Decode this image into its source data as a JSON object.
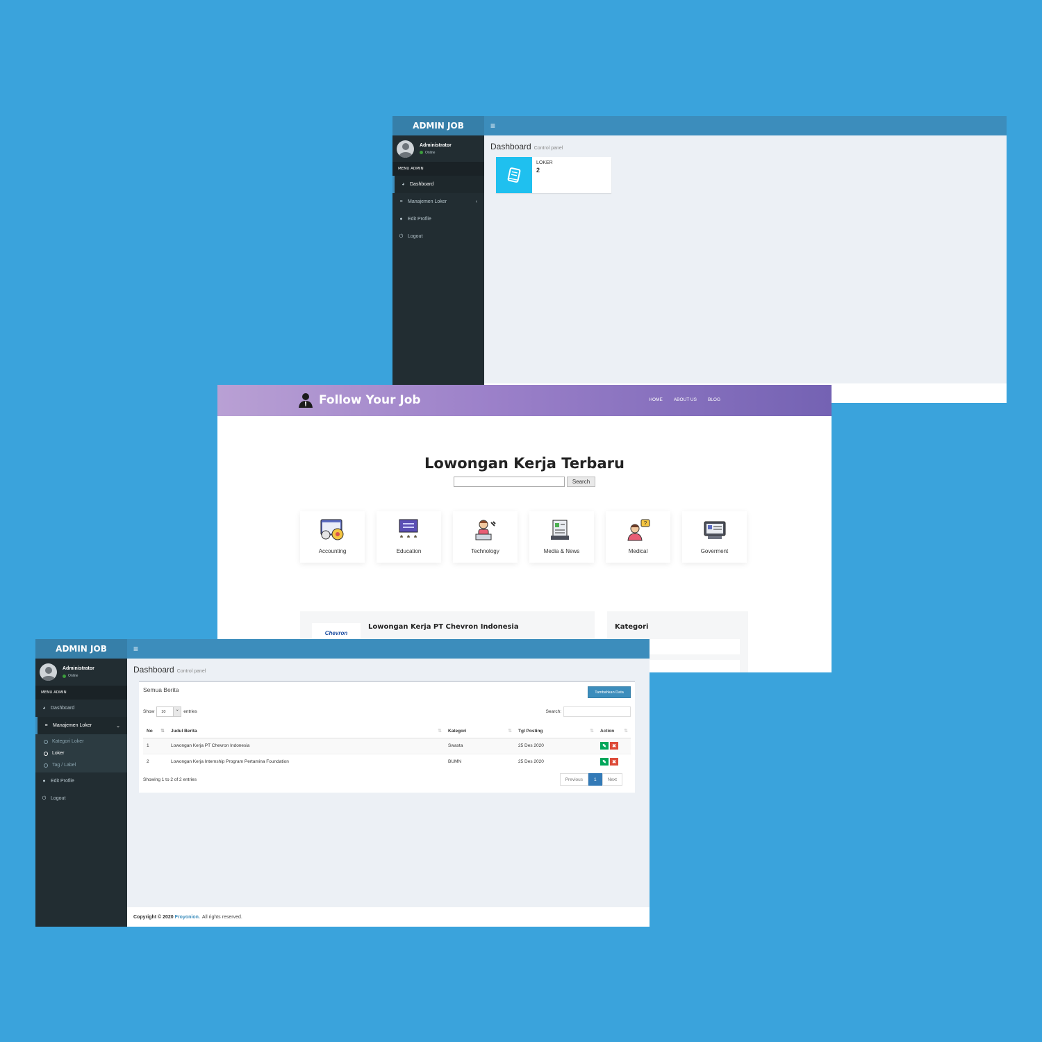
{
  "admin1": {
    "brand": "ADMIN JOB",
    "user": {
      "name": "Administrator",
      "status": "Online"
    },
    "menu_header": "MENU ADMIN",
    "menu": [
      {
        "label": "Dashboard",
        "icon": "dashboard-icon"
      },
      {
        "label": "Manajemen Loker",
        "icon": "list-icon"
      },
      {
        "label": "Edit Profile",
        "icon": "user-icon"
      },
      {
        "label": "Logout",
        "icon": "power-icon"
      }
    ],
    "page_title": "Dashboard",
    "page_subtitle": "Control panel",
    "infobox": {
      "label": "LOKER",
      "value": "2"
    }
  },
  "site": {
    "brand": "Follow Your Job",
    "nav": [
      "HOME",
      "ABOUT US",
      "BLOG"
    ],
    "heading": "Lowongan Kerja Terbaru",
    "search_button": "Search",
    "categories": [
      "Accounting",
      "Education",
      "Technology",
      "Media & News",
      "Medical",
      "Goverment"
    ],
    "job": {
      "logo_text": "Chevron",
      "title": "Lowongan Kerja PT Chevron Indonesia"
    },
    "sidebar_title": "Kategori"
  },
  "admin2": {
    "brand": "ADMIN JOB",
    "user": {
      "name": "Administrator",
      "status": "Online"
    },
    "menu_header": "MENU ADMIN",
    "menu": {
      "dashboard": "Dashboard",
      "manajemen": "Manajemen Loker",
      "sub": [
        "Kategori Loker",
        "Loker",
        "Tag / Label"
      ],
      "edit_profile": "Edit Profile",
      "logout": "Logout"
    },
    "page_title": "Dashboard",
    "page_subtitle": "Control panel",
    "box_title": "Semua Berita",
    "add_button": "Tambahkan Data",
    "show_label": "Show",
    "entries_value": "10",
    "entries_label": "entries",
    "search_label": "Search:",
    "columns": [
      "No",
      "Judul Berita",
      "Kategori",
      "Tgl Posting",
      "Action"
    ],
    "rows": [
      {
        "no": "1",
        "judul": "Lowongan Kerja PT Chevron Indonesia",
        "kategori": "Swasta",
        "tgl": "25 Des 2020"
      },
      {
        "no": "2",
        "judul": "Lowongan Kerja Internship Program Pertamina Foundation",
        "kategori": "BUMN",
        "tgl": "25 Des 2020"
      }
    ],
    "info": "Showing 1 to 2 of 2 entries",
    "pager": {
      "prev": "Previous",
      "current": "1",
      "next": "Next"
    },
    "footer": {
      "copyright": "Copyright © 2020",
      "company": "Froyonion.",
      "rights": "All rights reserved."
    }
  }
}
